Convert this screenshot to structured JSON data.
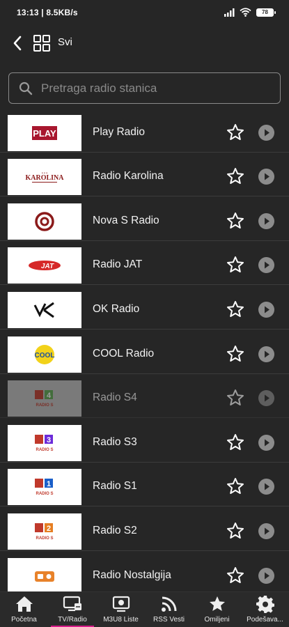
{
  "status": {
    "time_speed": "13:13 | 8.5KB/s",
    "battery": "78"
  },
  "topbar": {
    "back_icon": "chevron-left-icon",
    "grid_icon": "grid-icon",
    "category_label": "Svi"
  },
  "search": {
    "placeholder": "Pretraga radio stanica",
    "value": ""
  },
  "stations": [
    {
      "name": "Play Radio",
      "favorite": false,
      "enabled": true
    },
    {
      "name": "Radio Karolina",
      "favorite": false,
      "enabled": true
    },
    {
      "name": "Nova S Radio",
      "favorite": false,
      "enabled": true
    },
    {
      "name": "Radio JAT",
      "favorite": false,
      "enabled": true
    },
    {
      "name": "OK Radio",
      "favorite": false,
      "enabled": true
    },
    {
      "name": "COOL Radio",
      "favorite": false,
      "enabled": true
    },
    {
      "name": "Radio S4",
      "favorite": false,
      "enabled": false
    },
    {
      "name": "Radio S3",
      "favorite": false,
      "enabled": true
    },
    {
      "name": "Radio S1",
      "favorite": false,
      "enabled": true
    },
    {
      "name": "Radio S2",
      "favorite": false,
      "enabled": true
    },
    {
      "name": "Radio Nostalgija",
      "favorite": false,
      "enabled": true
    }
  ],
  "logos": {
    "play": "PLAY",
    "karolina": "KAROLINA",
    "s4": "4",
    "s3": "3",
    "s1": "1",
    "s2": "2",
    "radios": "RADIO S",
    "cool": "COOL",
    "jat": "JAT"
  },
  "bottom_nav": [
    {
      "label": "Početna",
      "icon": "home-icon",
      "active": false
    },
    {
      "label": "TV/Radio",
      "icon": "tv-radio-icon",
      "active": true
    },
    {
      "label": "M3U8 Liste",
      "icon": "m3u8-list-icon",
      "active": false
    },
    {
      "label": "RSS Vesti",
      "icon": "rss-icon",
      "active": false
    },
    {
      "label": "Omiljeni",
      "icon": "star-icon",
      "active": false
    },
    {
      "label": "Podešava...",
      "icon": "gear-icon",
      "active": false
    }
  ],
  "colors": {
    "background": "#262626",
    "accent": "#d81b8a",
    "icon_gray": "#8c8c8c"
  }
}
